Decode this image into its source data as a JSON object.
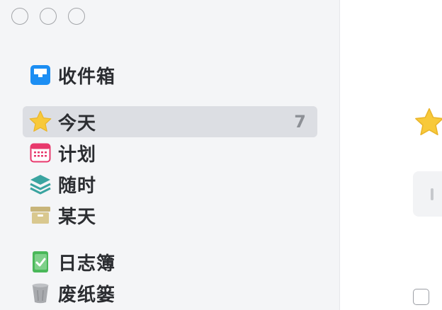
{
  "window": {
    "controls": [
      "close",
      "minimize",
      "zoom"
    ]
  },
  "sidebar": {
    "items": [
      {
        "label": "收件箱",
        "icon": "inbox-icon",
        "color": "#1c8ef3"
      },
      {
        "label": "今天",
        "icon": "star-icon",
        "color": "#f8c93a",
        "count": "7",
        "selected": true
      },
      {
        "label": "计划",
        "icon": "calendar-icon",
        "color": "#e8386c"
      },
      {
        "label": "随时",
        "icon": "layers-icon",
        "color": "#3aa4a0"
      },
      {
        "label": "某天",
        "icon": "archive-box-icon",
        "color": "#c8b57a"
      },
      {
        "label": "日志簿",
        "icon": "logbook-icon",
        "color": "#4ab859"
      },
      {
        "label": "废纸篓",
        "icon": "trash-icon",
        "color": "#a8aaae"
      }
    ]
  },
  "main": {
    "header_icon": "star-icon"
  }
}
